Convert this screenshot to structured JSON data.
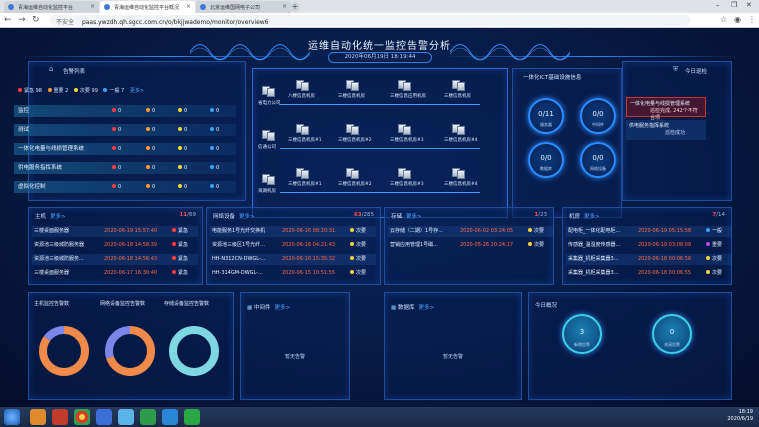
{
  "browser": {
    "tabs": [
      {
        "label": "青海运维自动化监控平台"
      },
      {
        "label": "青海运维自动化监控平台概况"
      },
      {
        "label": "北京运维国网电子公司"
      }
    ],
    "url_prefix": "不安全",
    "url": "paas.ywzdh.qh.sgcc.com.cn/o/bkjjwademo/monitor/overview6"
  },
  "dashboard": {
    "title": "运维自动化统一监控告警分析",
    "datetime": "2020年06月19日 18:19:44"
  },
  "alarm_panel": {
    "title": "告警列表",
    "legend": [
      {
        "label": "紧急 98",
        "color": "#ff3b3b"
      },
      {
        "label": "重要 2",
        "color": "#ff9a2e"
      },
      {
        "label": "次要 99",
        "color": "#f5d23a"
      },
      {
        "label": "一般 7",
        "color": "#3aa0ff"
      }
    ],
    "more": "更多>",
    "rows": [
      {
        "name": "监控",
        "c": [
          "0",
          "0",
          "0",
          "0"
        ]
      },
      {
        "name": "测试",
        "c": [
          "0",
          "0",
          "0",
          "0"
        ]
      },
      {
        "name": "一体化电量与线损管理系统",
        "c": [
          "0",
          "0",
          "0",
          "0"
        ]
      },
      {
        "name": "供电服务指挥系统",
        "c": [
          "0",
          "0",
          "0",
          "0"
        ]
      },
      {
        "name": "虚拟化控制",
        "c": [
          "0",
          "0",
          "0",
          "0"
        ]
      }
    ]
  },
  "topology": {
    "rows": [
      {
        "company": "省电力公司",
        "nodes": [
          "八楼信息机房",
          "三楼信息机房",
          "三楼信息应用机房",
          "三楼信息机房"
        ]
      },
      {
        "company": "信通公司",
        "nodes": [
          "三楼信息机房#1",
          "三楼信息机房#2",
          "三楼信息机房#3",
          "三楼信息机房#4"
        ]
      },
      {
        "company": "海湖机房",
        "nodes": [
          "三楼信息机房#1",
          "三楼信息机房#2",
          "三楼信息机房#3",
          "三楼信息机房#4"
        ]
      }
    ]
  },
  "stats_panel": {
    "title": "一体化ICT基础设施信息",
    "circles": [
      {
        "value": "0/11",
        "label": "服务器"
      },
      {
        "value": "0/0",
        "label": "中间件"
      },
      {
        "value": "0/0",
        "label": "数据库"
      },
      {
        "value": "0/0",
        "label": "网络设备"
      }
    ]
  },
  "today_panel": {
    "title": "今日巡检",
    "items": [
      {
        "name": "一体化电量与线损管理系统",
        "status": "巡检完成, 242个不符合项"
      },
      {
        "name": "供电服务指挥系统",
        "status": "巡检成功"
      }
    ]
  },
  "host_panel": {
    "title": "主机",
    "more": "更多>",
    "count_alarm": "11",
    "count_total": "/69",
    "rows": [
      {
        "name": "三楼桌面服务器",
        "time": "2020-06-19 15:57:40",
        "level": "紧急",
        "color": "#ff3b3b"
      },
      {
        "name": "资源池三级城防服务器",
        "time": "2020-06-18 14:58:39",
        "level": "紧急",
        "color": "#ff3b3b"
      },
      {
        "name": "资源池三级城防服务...",
        "time": "2020-06-18 14:56:43",
        "level": "紧急",
        "color": "#ff3b3b"
      },
      {
        "name": "三楼桌面服务器",
        "time": "2020-06-17 16:30:40",
        "level": "紧急",
        "color": "#ff3b3b"
      }
    ]
  },
  "network_panel": {
    "title": "网络设备",
    "more": "更多>",
    "count_alarm": "63",
    "count_total": "/285",
    "rows": [
      {
        "name": "电能服务1号光纤交换机",
        "time": "2020-06-16 08:20:31",
        "level": "次要",
        "color": "#f5d23a"
      },
      {
        "name": "资源池三级区1号光纤...",
        "time": "2020-06-16 04:21:43",
        "level": "次要",
        "color": "#f5d23a"
      },
      {
        "name": "HH-N312CN-DWGL-...",
        "time": "2020-06-16 15:35:32",
        "level": "次要",
        "color": "#f5d23a"
      },
      {
        "name": "HH-314GM-DWGL-...",
        "time": "2020-06-15 10:51:55",
        "level": "次要",
        "color": "#f5d23a"
      }
    ]
  },
  "storage_panel": {
    "title": "存储",
    "more": "更多>",
    "count_alarm": "1",
    "count_total": "/23",
    "rows": [
      {
        "name": "云存储（二期）1号存...",
        "time": "2020-06-02 03:24:05",
        "level": "次要",
        "color": "#f5d23a"
      },
      {
        "name": "营销应用管理1号磁...",
        "time": "2020-05-26 20:24:17",
        "level": "次要",
        "color": "#f5d23a"
      }
    ]
  },
  "room_panel": {
    "title": "机房",
    "more": "更多>",
    "count_alarm": "7",
    "count_total": "/14",
    "rows": [
      {
        "name": "配电柜_一体化配电柜...",
        "time": "2020-06-19 05:15:58",
        "level": "一般",
        "color": "#3aa0ff"
      },
      {
        "name": "传感器_温湿度传感器...",
        "time": "2020-06-19 03:08:09",
        "level": "重要",
        "color": "#c040ff"
      },
      {
        "name": "采集器_机柜采集器3...",
        "time": "2020-06-18 00:06:58",
        "level": "次要",
        "color": "#f5d23a"
      },
      {
        "name": "采集器_机柜采集器3...",
        "time": "2020-06-18 00:06:55",
        "level": "次要",
        "color": "#f5d23a"
      }
    ]
  },
  "ratio_panel": {
    "donuts": [
      {
        "label": "主机监控告警数",
        "colors": [
          "#f08a4b",
          "#7b86e8"
        ],
        "fractions": [
          0.85,
          0.15
        ]
      },
      {
        "label": "网络设备监控告警数",
        "colors": [
          "#f08a4b",
          "#7b86e8"
        ],
        "fractions": [
          0.7,
          0.3
        ]
      },
      {
        "label": "存储设备监控告警数",
        "colors": [
          "#7fd7e3"
        ],
        "fractions": [
          1.0
        ]
      }
    ]
  },
  "middleware_panel": {
    "title": "中间件",
    "more": "更多>",
    "empty": "暂无告警"
  },
  "database_panel": {
    "title": "数据库",
    "more": "更多>",
    "empty": "暂无告警"
  },
  "overview_panel": {
    "title": "今日概况",
    "cards": [
      {
        "value": "3",
        "label": "新增告警"
      },
      {
        "value": "0",
        "label": "关闭告警"
      }
    ]
  },
  "taskbar": {
    "time": "18:19",
    "date": "2020/6/19"
  }
}
